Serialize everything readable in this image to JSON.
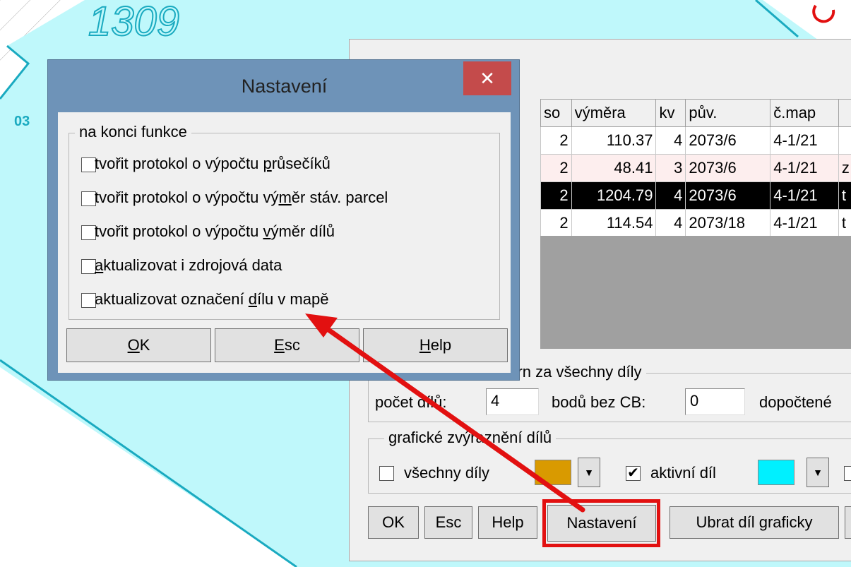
{
  "map": {
    "parcel_number": "1309",
    "label_fragment": "03",
    "colors": {
      "parcel_fill": "#bff8fb",
      "parcel_outline": "#1aaac0",
      "hatch": "#a8a8a8",
      "marker": "#e21010"
    }
  },
  "main_window": {
    "table": {
      "columns": [
        "so",
        "výměra",
        "kv",
        "pův.",
        "č.map",
        ""
      ],
      "rows": [
        {
          "so": "2",
          "vymera": "110.37",
          "kv": "4",
          "puv": "2073/6",
          "cmap": "4-1/21",
          "extra": "",
          "style": "normal"
        },
        {
          "so": "2",
          "vymera": "48.41",
          "kv": "3",
          "puv": "2073/6",
          "cmap": "4-1/21",
          "extra": "z",
          "style": "pink"
        },
        {
          "so": "2",
          "vymera": "1204.79",
          "kv": "4",
          "puv": "2073/6",
          "cmap": "4-1/21",
          "extra": "t",
          "style": "selected"
        },
        {
          "so": "2",
          "vymera": "114.54",
          "kv": "4",
          "puv": "2073/18",
          "cmap": "4-1/21",
          "extra": "t",
          "style": "normal"
        }
      ]
    },
    "summary": {
      "title": "úhrn za všechny díly",
      "count_label": "počet dílů:",
      "count_value": "4",
      "points_label": "bodů bez CB:",
      "points_value": "0",
      "computed_label": "dopočtené"
    },
    "graphics": {
      "title": "grafické zvýraznění dílů",
      "all_parts_label": "všechny díly",
      "all_parts_checked": false,
      "all_parts_color": "#d99a00",
      "active_part_label": "aktivní díl",
      "active_part_checked": true,
      "active_part_color": "#00f0ff"
    },
    "buttons": {
      "ok": "OK",
      "esc": "Esc",
      "help": "Help",
      "settings": "Nastavení",
      "remove_part": "Ubrat díl graficky"
    }
  },
  "dialog": {
    "title": "Nastavení",
    "close_glyph": "✕",
    "group_title": "na konci funkce",
    "options": [
      {
        "pre": "tvořit protokol o výpočtu ",
        "key": "p",
        "post": "růsečíků",
        "checked": false
      },
      {
        "pre": "tvořit protokol o výpočtu vý",
        "key": "m",
        "post": "ěr stáv. parcel",
        "checked": false
      },
      {
        "pre": "tvořit protokol o výpočtu ",
        "key": "v",
        "post": "ýměr dílů",
        "checked": false
      },
      {
        "pre": "",
        "key": "a",
        "post": "ktualizovat i zdrojová data",
        "checked": false
      },
      {
        "pre": "aktualizovat označení ",
        "key": "d",
        "post": "ílu v mapě",
        "checked": false
      }
    ],
    "buttons": {
      "ok": {
        "key": "O",
        "rest": "K"
      },
      "esc": {
        "key": "E",
        "rest": "sc"
      },
      "help": {
        "key": "H",
        "rest": "elp"
      }
    }
  },
  "annotation": {
    "color": "#e21010"
  }
}
